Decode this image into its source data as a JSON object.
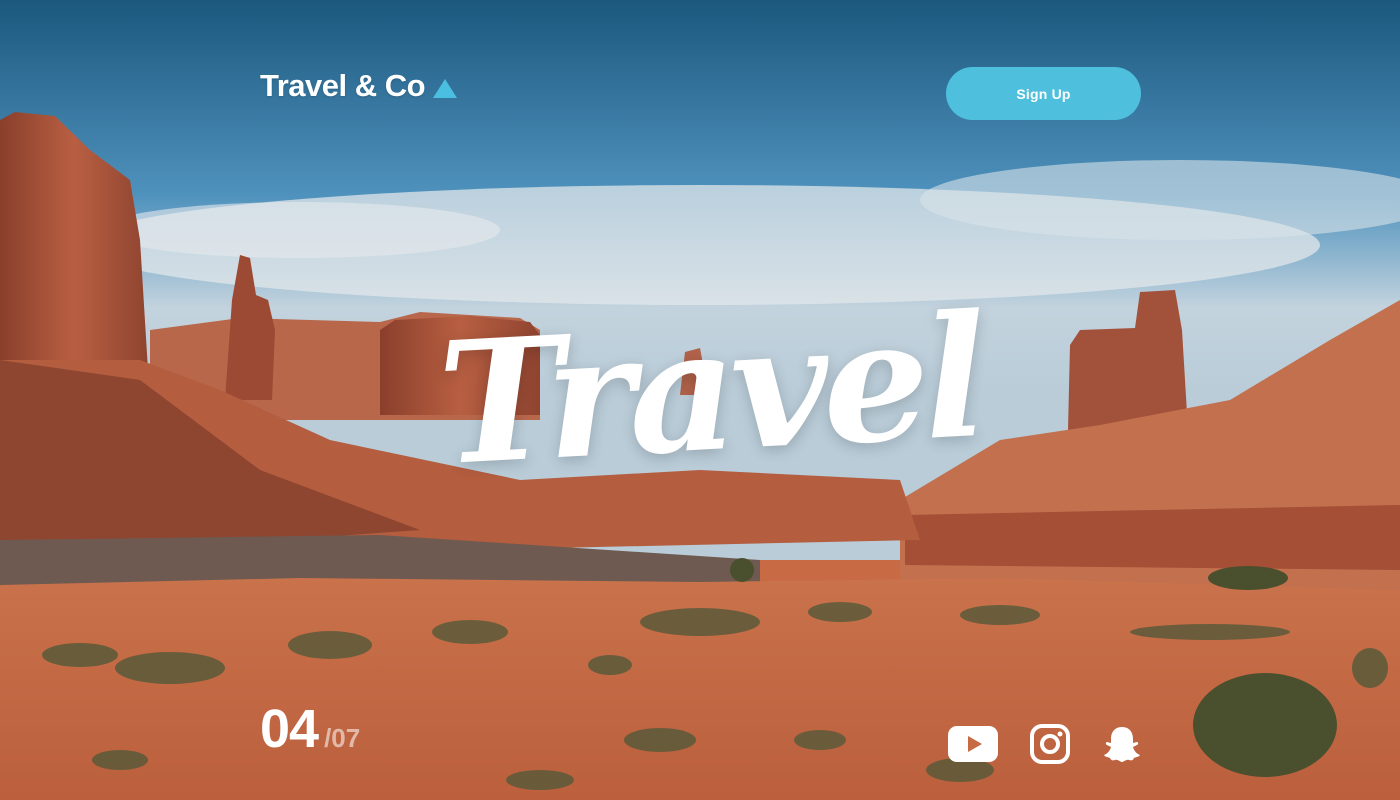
{
  "header": {
    "brand": "Travel & Co",
    "signup_label": "Sign Up"
  },
  "hero": {
    "title": "Travel"
  },
  "pagination": {
    "current": "04",
    "total": "/07"
  },
  "social": [
    {
      "icon": "youtube-icon"
    },
    {
      "icon": "instagram-icon"
    },
    {
      "icon": "snapchat-icon"
    }
  ],
  "colors": {
    "accent": "#4ec0de",
    "sky_top": "#1f5f86",
    "sand": "#d2825d",
    "rock": "#b35a3b"
  }
}
